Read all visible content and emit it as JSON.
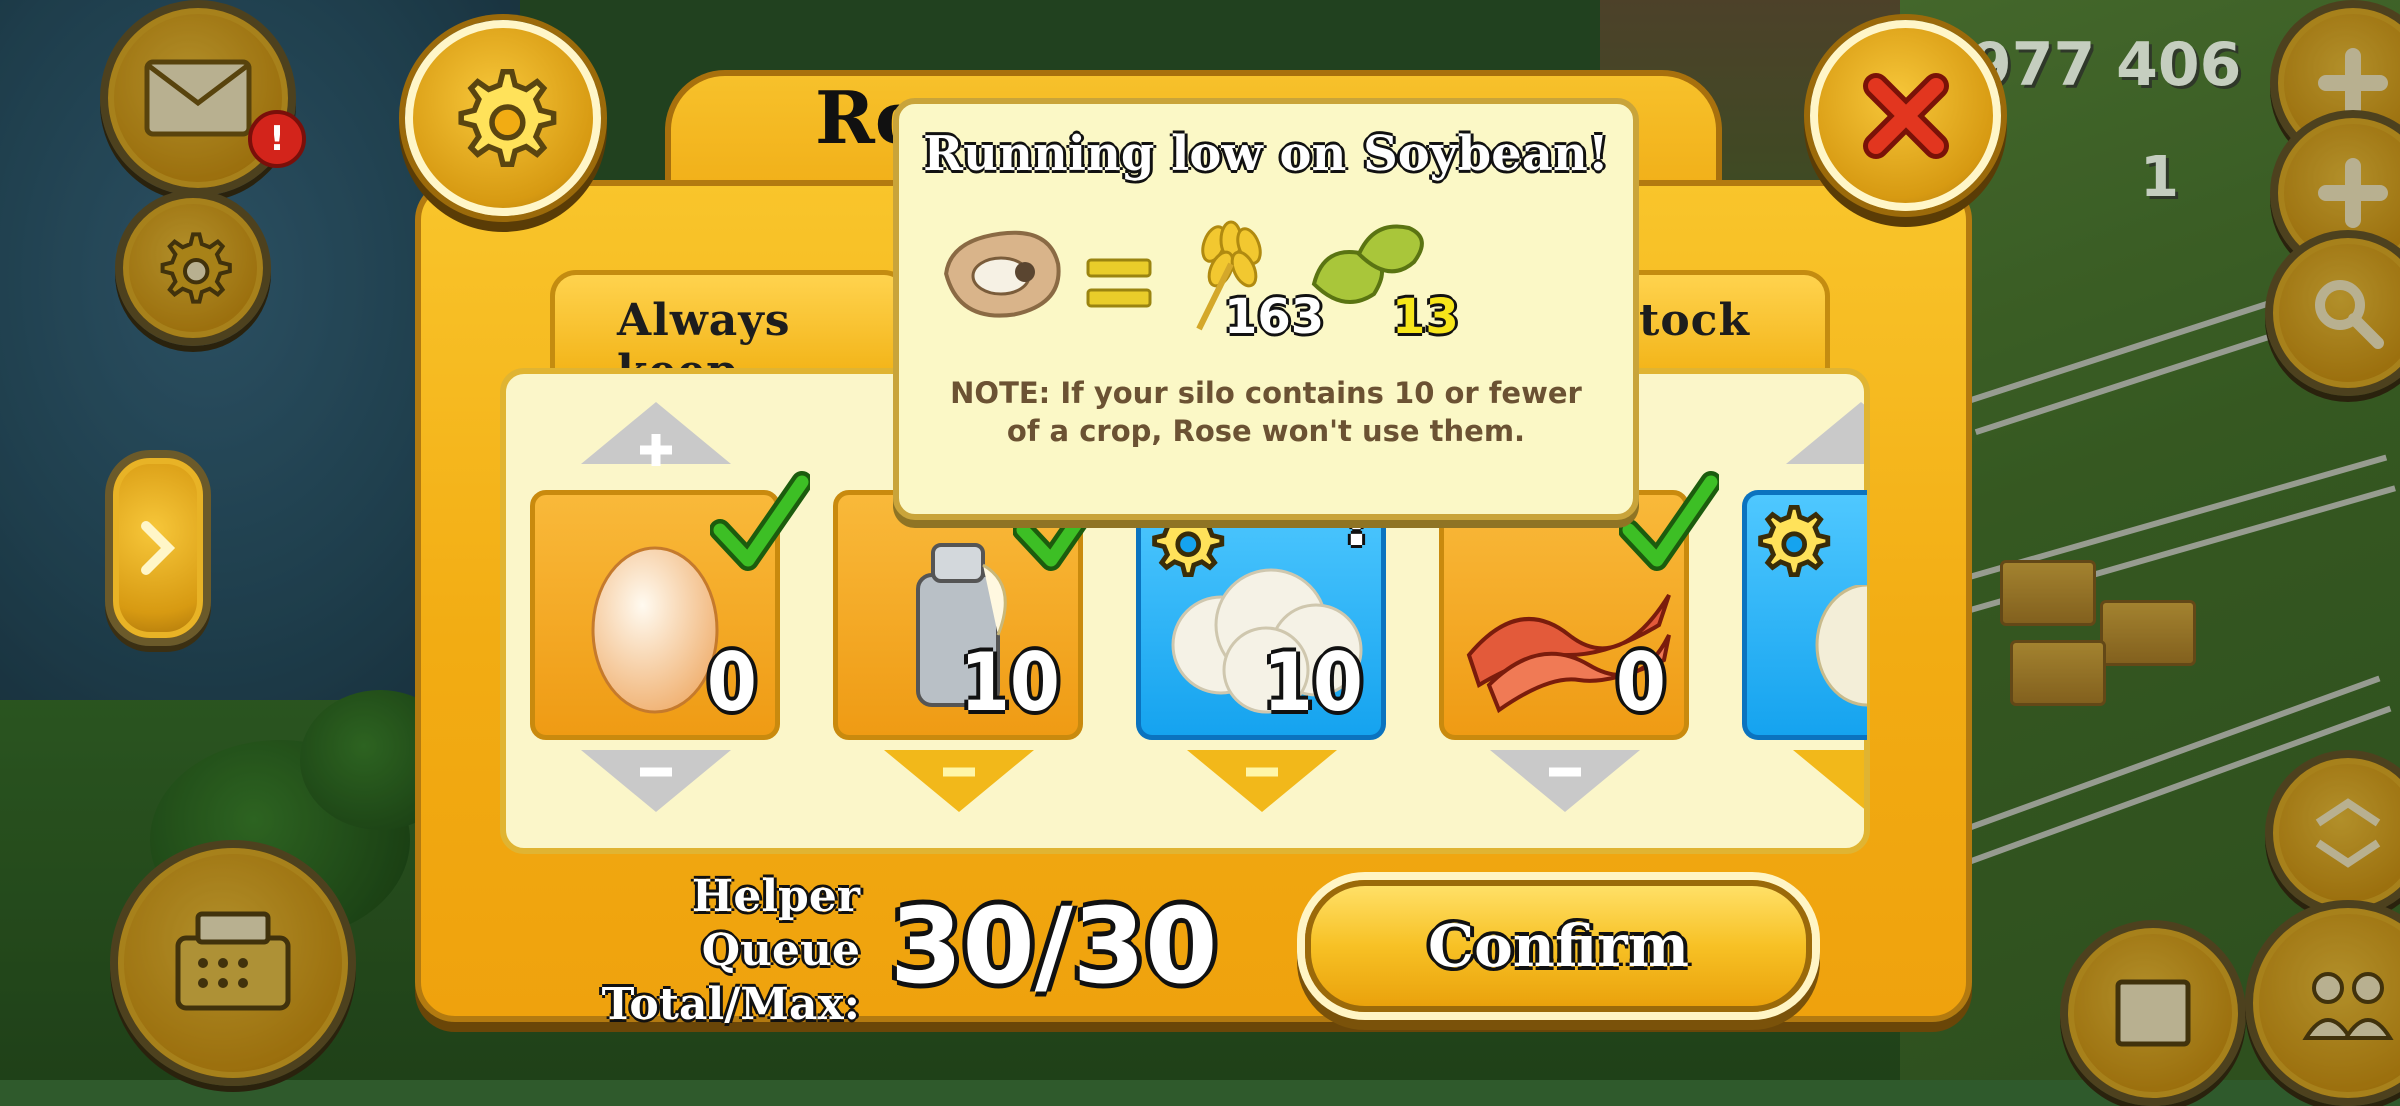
{
  "hud": {
    "coins": "977 406",
    "diamonds": "1",
    "mail_badge": "!"
  },
  "dialog": {
    "title": "Ro",
    "tab_left": "Always keep",
    "tab_right": "tock"
  },
  "items": [
    {
      "name": "egg",
      "qty": "0",
      "checked": true,
      "theme": "orange"
    },
    {
      "name": "milk",
      "qty": "10",
      "checked": true,
      "theme": "orange"
    },
    {
      "name": "wool",
      "qty": "10",
      "checked": false,
      "theme": "blue",
      "alert": "!"
    },
    {
      "name": "bacon",
      "qty": "0",
      "checked": true,
      "theme": "orange"
    },
    {
      "name": "partial-item",
      "qty": "",
      "checked": false,
      "theme": "blue"
    }
  ],
  "queue": {
    "label_line1": "Helper Queue",
    "label_line2": "Total/Max:",
    "value": "30/30"
  },
  "confirm_label": "Confirm",
  "popup": {
    "title": "Running low on Soybean!",
    "wheat_qty": "163",
    "soybean_qty": "13",
    "note": "NOTE: If your silo contains 10 or fewer of a crop, Rose won't use them."
  },
  "colors": {
    "dialog_orange": "#f2ac13",
    "panel_cream": "#fbf6c9",
    "item_blue": "#15a3ef",
    "check_green": "#3dbf25",
    "close_red": "#e2361f"
  }
}
